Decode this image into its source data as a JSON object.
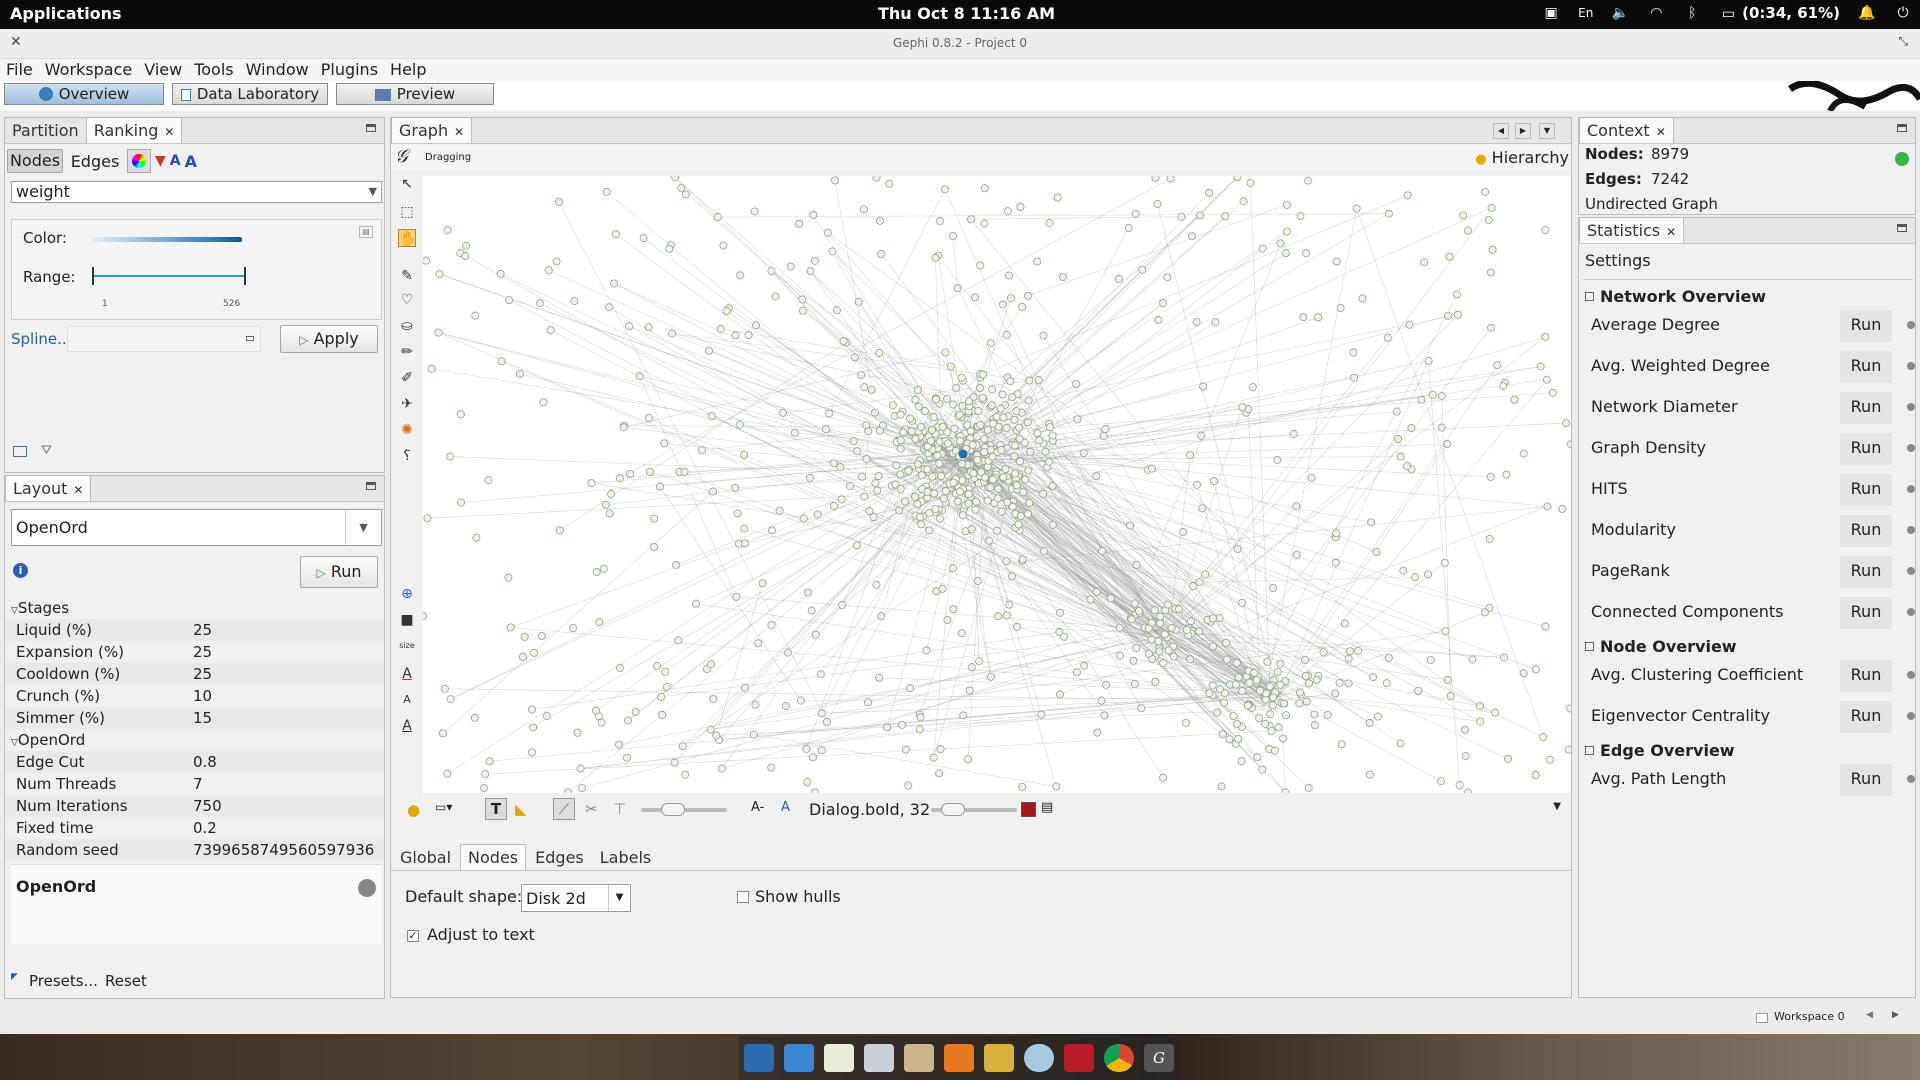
{
  "top_panel": {
    "app_menu": "Applications",
    "clock": "Thu Oct  8   11:16 AM",
    "keyboard": "En",
    "battery": "(0:34, 61%)"
  },
  "window": {
    "title": "Gephi 0.8.2 - Project 0"
  },
  "menu": [
    "File",
    "Workspace",
    "View",
    "Tools",
    "Window",
    "Plugins",
    "Help"
  ],
  "perspectives": {
    "overview": "Overview",
    "data_lab": "Data Laboratory",
    "preview": "Preview"
  },
  "ranking": {
    "tabs": {
      "partition": "Partition",
      "ranking": "Ranking"
    },
    "subtabs": {
      "nodes": "Nodes",
      "edges": "Edges"
    },
    "attribute": "weight",
    "color_label": "Color:",
    "range_label": "Range:",
    "range_min": "1",
    "range_max": "526",
    "spline": "Spline...",
    "apply": "Apply"
  },
  "layout": {
    "tab": "Layout",
    "algorithm": "OpenOrd",
    "run": "Run",
    "group_stages": "Stages",
    "stages": [
      {
        "k": "Liquid (%)",
        "v": "25"
      },
      {
        "k": "Expansion (%)",
        "v": "25"
      },
      {
        "k": "Cooldown (%)",
        "v": "25"
      },
      {
        "k": "Crunch (%)",
        "v": "10"
      },
      {
        "k": "Simmer (%)",
        "v": "15"
      }
    ],
    "group_openord": "OpenOrd",
    "params": [
      {
        "k": "Edge Cut",
        "v": "0.8"
      },
      {
        "k": "Num Threads",
        "v": "7"
      },
      {
        "k": "Num Iterations",
        "v": "750"
      },
      {
        "k": "Fixed time",
        "v": "0.2"
      },
      {
        "k": "Random seed",
        "v": "7399658749560597936"
      }
    ],
    "description_title": "OpenOrd",
    "presets": "Presets...",
    "reset": "Reset"
  },
  "graph": {
    "tab": "Graph",
    "mode": "Dragging",
    "hierarchy": "Hierarchy",
    "font_label": "Dialog.bold, 32",
    "label_a_minus": "A-",
    "label_a": "A",
    "size_tool": "size",
    "bottom_tabs": {
      "global": "Global",
      "nodes": "Nodes",
      "edges": "Edges",
      "labels": "Labels"
    },
    "default_shape_label": "Default shape:",
    "default_shape_value": "Disk 2d",
    "show_hulls": "Show hulls",
    "adjust_to_text": "Adjust to text"
  },
  "context": {
    "tab": "Context",
    "nodes_label": "Nodes:",
    "nodes_value": "8979",
    "edges_label": "Edges:",
    "edges_value": "7242",
    "graph_type": "Undirected Graph"
  },
  "statistics": {
    "tab": "Statistics",
    "settings": "Settings",
    "run_label": "Run",
    "network_overview": "Network Overview",
    "network_items": [
      "Average Degree",
      "Avg. Weighted Degree",
      "Network Diameter",
      "Graph Density",
      "HITS",
      "Modularity",
      "PageRank",
      "Connected Components"
    ],
    "node_overview": "Node Overview",
    "node_items": [
      "Avg. Clustering Coefficient",
      "Eigenvector Centrality"
    ],
    "edge_overview": "Edge Overview",
    "edge_items": [
      "Avg. Path Length"
    ]
  },
  "status": {
    "workspace": "Workspace 0"
  }
}
